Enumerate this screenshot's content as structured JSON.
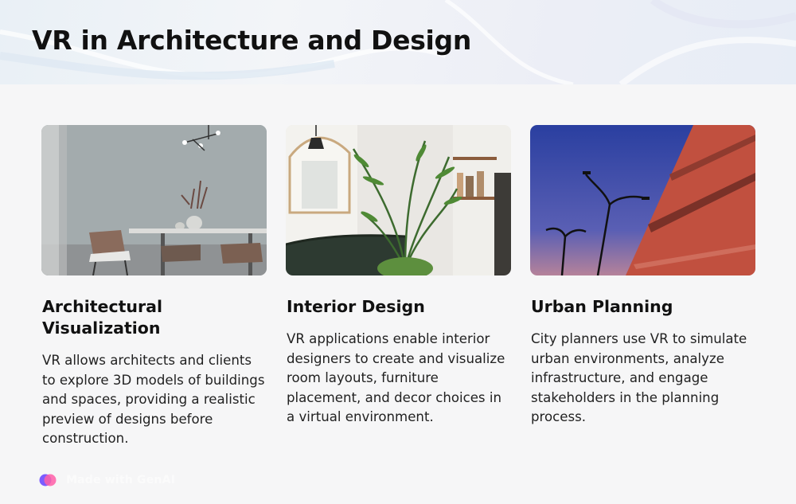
{
  "header": {
    "title": "VR in Architecture and Design"
  },
  "cards": [
    {
      "title": "Architectural Visualization",
      "body": "VR allows architects and clients to explore 3D models of buildings and spaces, providing a realistic preview of designs before construction.",
      "image": "dining-room-photo"
    },
    {
      "title": "Interior Design",
      "body": "VR applications enable interior designers to create and visualize room layouts, furniture placement, and decor choices in a virtual environment.",
      "image": "living-room-plant-photo"
    },
    {
      "title": "Urban Planning",
      "body": "City planners use VR to simulate urban environments, analyze infrastructure, and engage stakeholders in the planning process.",
      "image": "red-building-streetlights-photo"
    }
  ],
  "footer": {
    "brand_label": "Made with GenAI"
  }
}
